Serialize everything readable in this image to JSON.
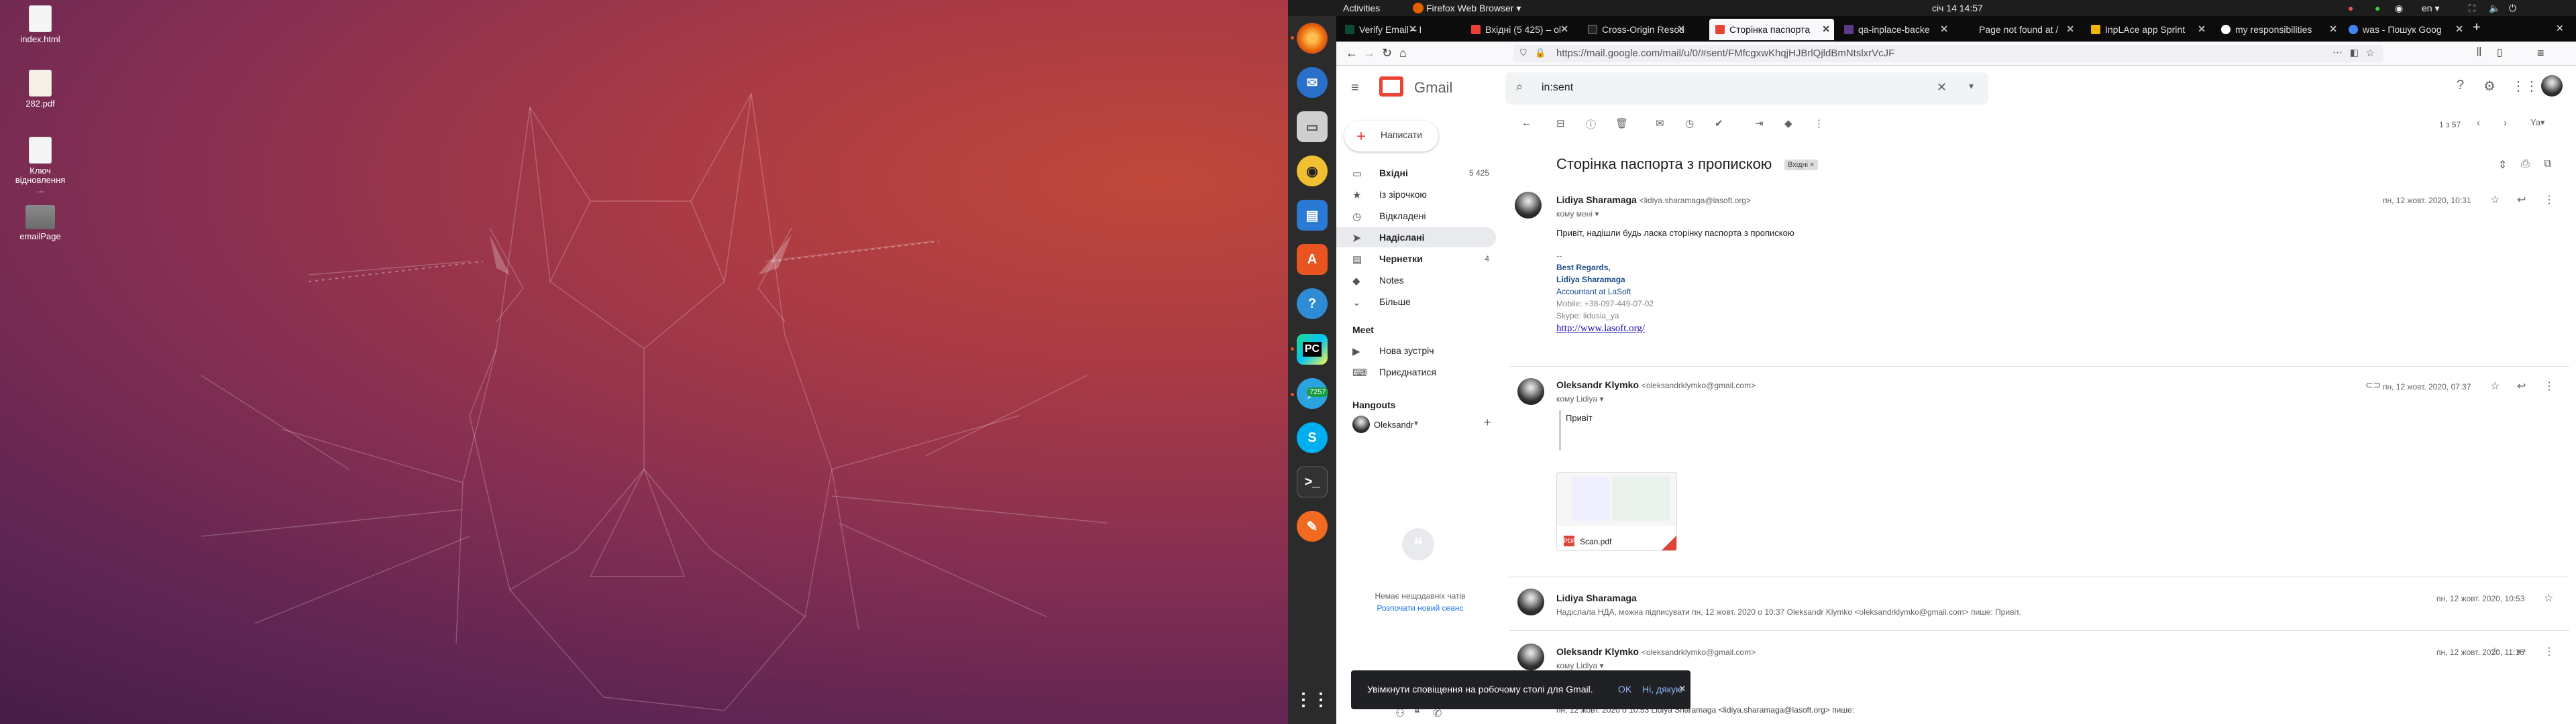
{
  "desktop": {
    "icons": [
      {
        "label": "index.html",
        "kind": "doc"
      },
      {
        "label": "282.pdf",
        "kind": "pdf"
      },
      {
        "label": "Ключ відновлення ...",
        "kind": "doc"
      },
      {
        "label": "emailPage",
        "kind": "folder"
      }
    ]
  },
  "panel": {
    "activities": "Activities",
    "app": "Firefox Web Browser ▾",
    "clock": "січ 14  14:57",
    "lang": "en ▾"
  },
  "dock": {
    "badge": "7257"
  },
  "browser": {
    "tabs": [
      {
        "label": "Verify Email – Djange",
        "color": "#0c4b33"
      },
      {
        "label": "Вхідні (5 425) – ol",
        "color": "#ea4335"
      },
      {
        "label": "Cross-Origin Resou",
        "color": "#222"
      },
      {
        "label": "Сторінка паспорта",
        "color": "#ea4335"
      },
      {
        "label": "qa-inplace-backe",
        "color": "#5e3a8a"
      },
      {
        "label": "Page not found at /",
        "color": "#ffffff"
      },
      {
        "label": "InpLAce app Sprint",
        "color": "#f4b400"
      },
      {
        "label": "my responsibilities",
        "color": "#333"
      },
      {
        "label": "was - Пошук Goog",
        "color": "#4285f4"
      }
    ],
    "url": "https://mail.google.com/mail/u/0/#sent/FMfcgxwKhqjHJBrlQjldBmNtslxrVcJF"
  },
  "gmail": {
    "logo": "Gmail",
    "compose": "Написати",
    "nav": [
      {
        "label": "Вхідні",
        "count": "5 425",
        "icon": "▭"
      },
      {
        "label": "Із зірочкою",
        "count": "",
        "icon": "★"
      },
      {
        "label": "Відкладені",
        "count": "",
        "icon": "◷"
      },
      {
        "label": "Надіслані",
        "count": "",
        "icon": "➤"
      },
      {
        "label": "Чернетки",
        "count": "4",
        "icon": "▤"
      },
      {
        "label": "Notes",
        "count": "",
        "icon": "◆"
      },
      {
        "label": "Більше",
        "count": "",
        "icon": "⌄"
      }
    ],
    "meet": {
      "title": "Meet",
      "new": "Нова зустріч",
      "join": "Приєднатися"
    },
    "hangouts": {
      "title": "Hangouts",
      "user": "Oleksandr",
      "empty": "Немає нещодавніх чатів",
      "start": "Розпочати новий сеанс"
    },
    "search": "in:sent",
    "pager": "1 з 57",
    "subject": "Сторінка паспорта з пропискою",
    "label": "Вхідні ×",
    "messages": [
      {
        "name": "Lidiya Sharamaga",
        "email": "<lidiya.sharamaga@lasoft.org>",
        "to": "кому мені ▾",
        "date": "пн, 12 жовт. 2020, 10:31",
        "body": "Привіт, надішли будь ласка сторінку паспорта з пропискою",
        "sig": [
          "--",
          "Best Regards,",
          "Lidiya Sharamaga",
          "Accountant at LaSoft",
          "Mobile: +38-097-449-07-02",
          "Skype: lidusia_ya"
        ],
        "link": "http://www.lasoft.org/"
      },
      {
        "name": "Oleksandr Klymko",
        "email": "<oleksandrklymko@gmail.com>",
        "to": "кому Lidiya ▾",
        "date": "пн, 12 жовт. 2020, 07:37",
        "body": "Привіт",
        "attachment": "Scan.pdf"
      },
      {
        "name": "Lidiya Sharamaga",
        "date": "пн, 12 жовт. 2020, 10:53",
        "snippet": "Надіслала НДА, можна підписувати пн, 12 жовт. 2020 о 10:37 Oleksandr Klymko <oleksandrklymko@gmail.com> пише: Привіт."
      },
      {
        "name": "Oleksandr Klymko",
        "email": "<oleksandrklymko@gmail.com>",
        "to": "кому Lidiya ▾",
        "date": "пн, 12 жовт. 2020, 11:16",
        "quote": "пн, 12 жовт. 2020 о 10:53 Lidiya Sharamaga <lidiya.sharamaga@lasoft.org> пише:"
      }
    ],
    "toast": {
      "text": "Увімкнути сповіщення на робочому столі для Gmail.",
      "ok": "OK",
      "no": "Ні, дякую"
    }
  }
}
